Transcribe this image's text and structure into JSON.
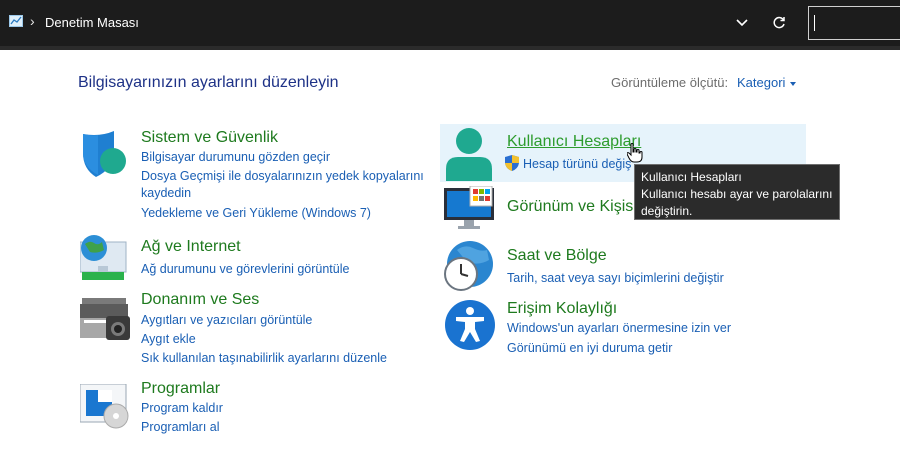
{
  "window": {
    "breadcrumb": "Denetim Masası",
    "separator": "›"
  },
  "header": {
    "title": "Bilgisayarınızın ayarlarını düzenleyin",
    "view_label": "Görüntüleme ölçütü:",
    "view_value": "Kategori"
  },
  "categories": {
    "system": {
      "title": "Sistem ve Güvenlik",
      "links": [
        "Bilgisayar durumunu gözden geçir",
        "Dosya Geçmişi ile dosyalarınızın yedek kopyalarını",
        "kaydedin",
        "Yedekleme ve Geri Yükleme (Windows 7)"
      ]
    },
    "network": {
      "title": "Ağ ve Internet",
      "links": [
        "Ağ durumunu ve görevlerini görüntüle"
      ]
    },
    "hardware": {
      "title": "Donanım ve Ses",
      "links": [
        "Aygıtları ve yazıcıları görüntüle",
        "Aygıt ekle",
        "Sık kullanılan taşınabilirlik ayarlarını düzenle"
      ]
    },
    "programs": {
      "title": "Programlar",
      "links": [
        "Program kaldır",
        "Programları al"
      ]
    },
    "users": {
      "title": "Kullanıcı Hesapları",
      "links": [
        "Hesap türünü değiş"
      ]
    },
    "appearance": {
      "title": "Görünüm ve Kişis",
      "links": []
    },
    "clock": {
      "title": "Saat ve Bölge",
      "links": [
        "Tarih, saat veya sayı biçimlerini değiştir"
      ]
    },
    "ease": {
      "title": "Erişim Kolaylığı",
      "links": [
        "Windows'un ayarları önermesine izin ver",
        "Görünümü en iyi duruma getir"
      ]
    }
  },
  "tooltip": {
    "line1": "Kullanıcı Hesapları",
    "line2": "Kullanıcı hesabı ayar ve parolalarını",
    "line3": "değiştirin."
  },
  "icons": {
    "breadcrumb_icon": "control-panel-icon",
    "system": "shield-icon",
    "network": "globe-network-icon",
    "hardware": "printer-camera-icon",
    "programs": "programs-disc-icon",
    "users": "user-icon",
    "appearance": "monitor-icon",
    "clock": "clock-globe-icon",
    "ease": "accessibility-icon"
  },
  "colors": {
    "category_title": "#1e7a1e",
    "link": "#1a5fb4",
    "page_title": "#1e3287",
    "hover_bg": "#e6f3fb",
    "topbar": "#1c1c1c"
  }
}
